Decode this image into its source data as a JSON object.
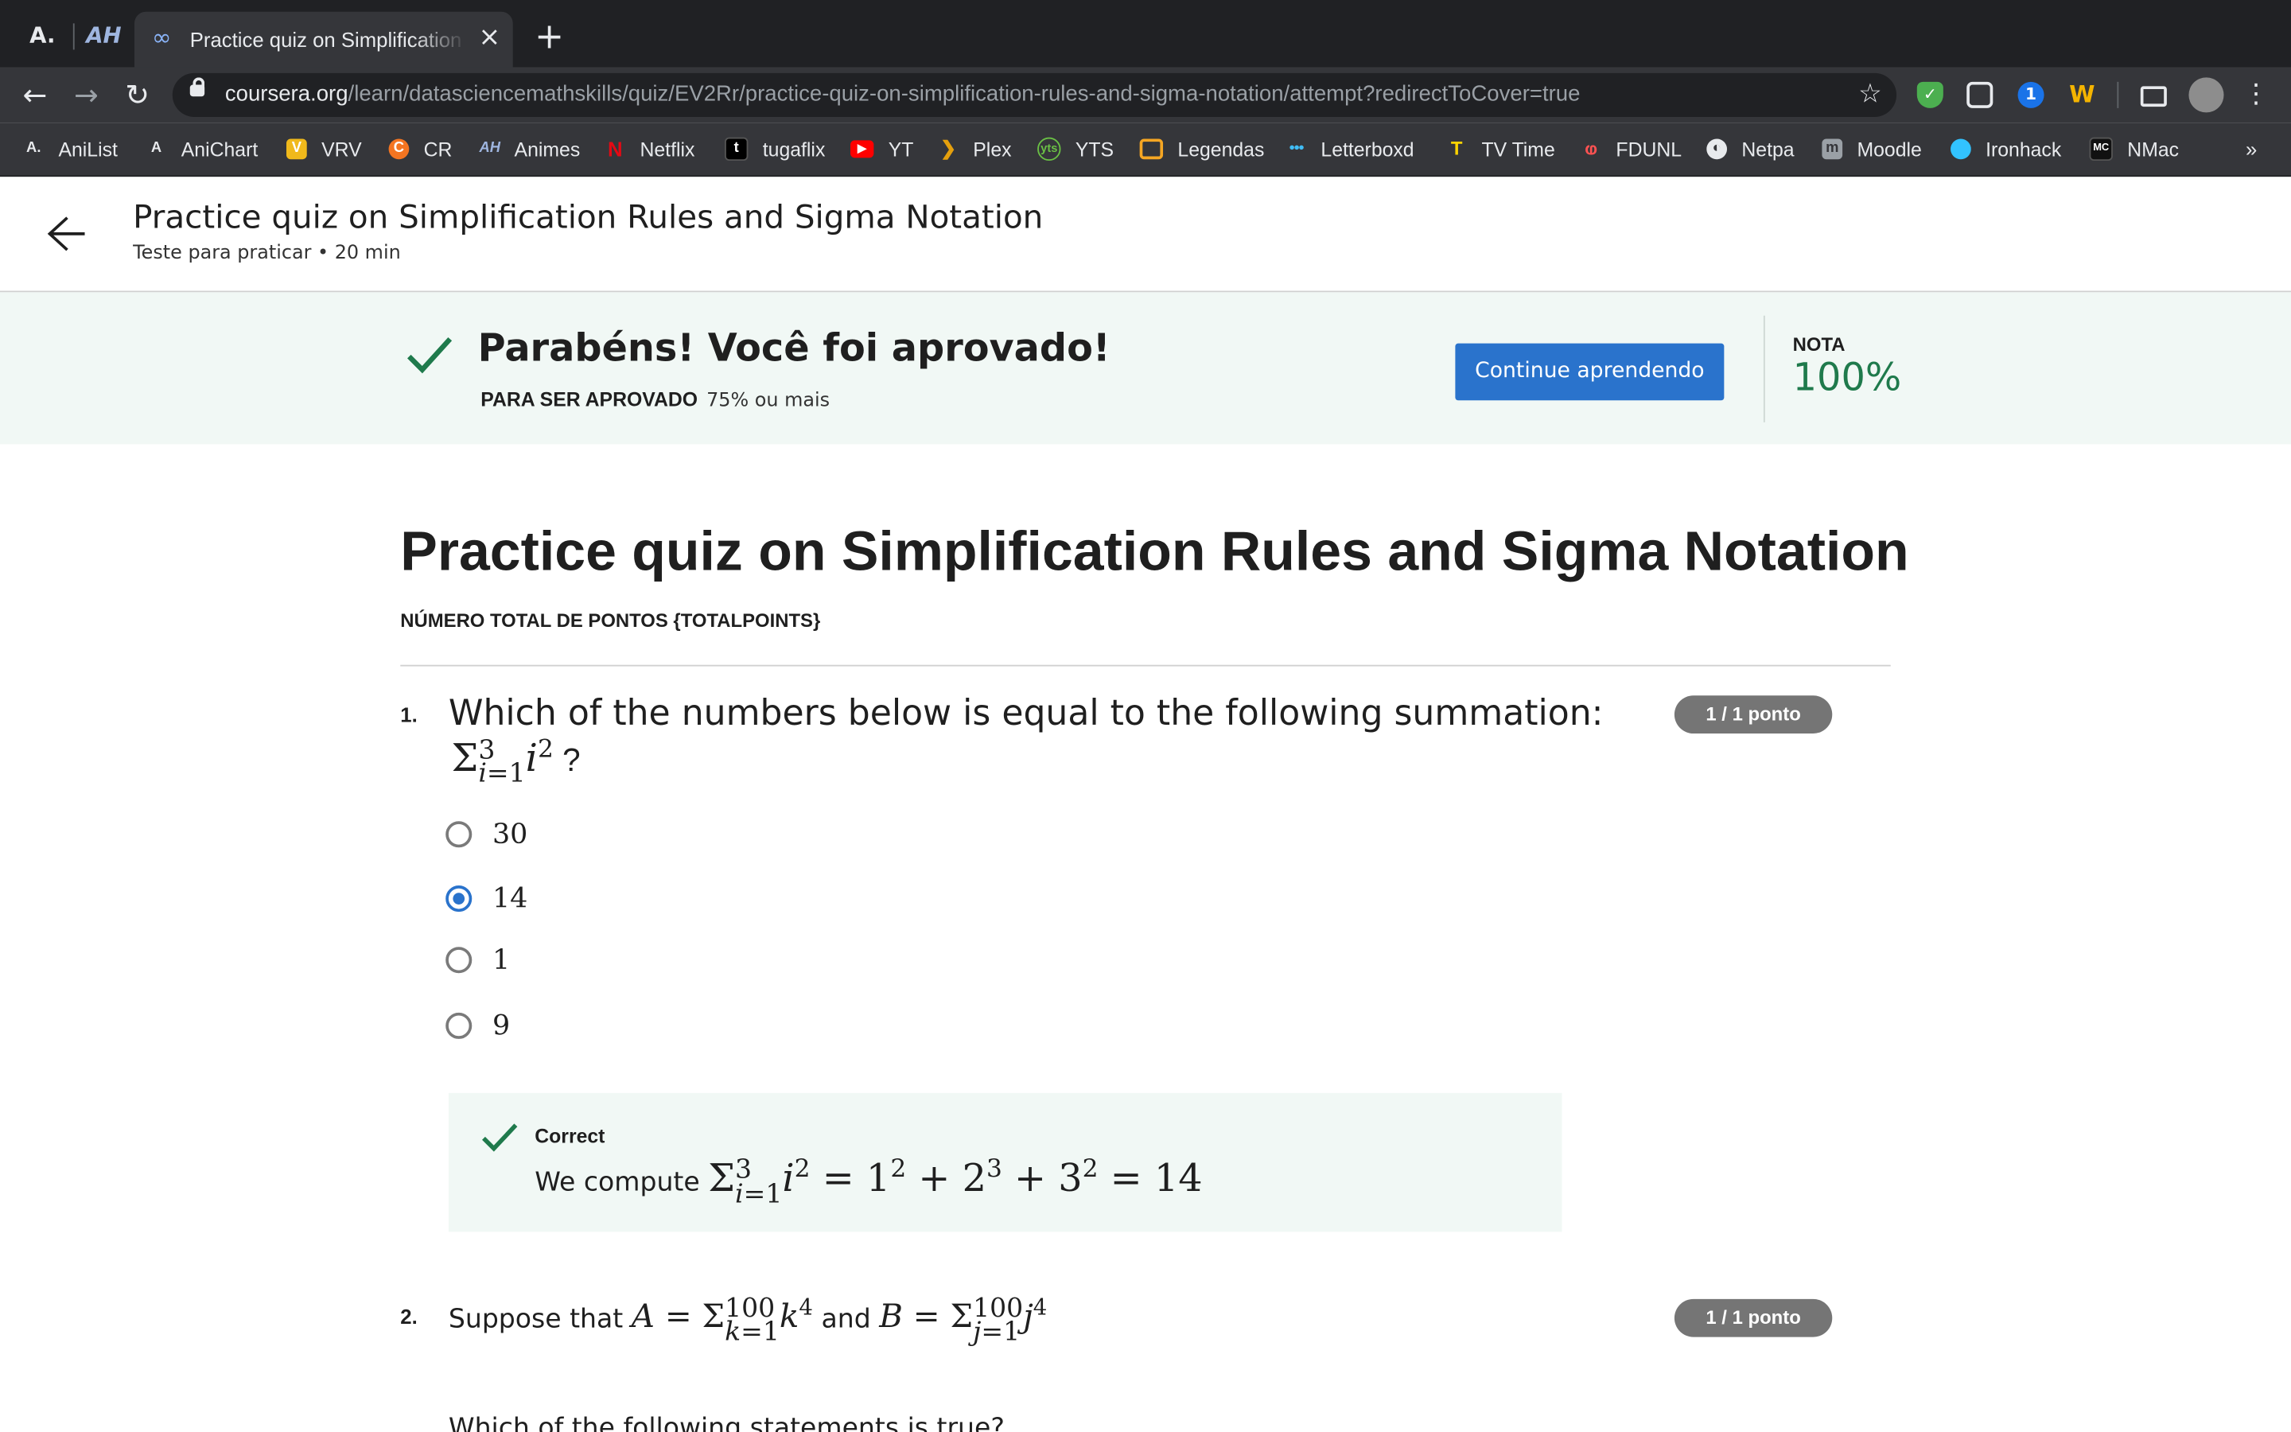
{
  "browser": {
    "tab_title": "Practice quiz on Simplification Rules and Sigma Notation | Coursera",
    "url_host": "coursera.org",
    "url_path": "/learn/datasciencemathskills/quiz/EV2Rr/practice-quiz-on-simplification-rules-and-sigma-notation/attempt?redirectToCover=true",
    "bookmarks": [
      {
        "label": "AniList",
        "color": "#3db4f2",
        "icon": "A."
      },
      {
        "label": "AniChart",
        "color": "#3db4f2",
        "icon": "A"
      },
      {
        "label": "VRV",
        "color": "#f0b91b",
        "icon": "V"
      },
      {
        "label": "CR",
        "color": "#f47521",
        "icon": "C"
      },
      {
        "label": "Animes",
        "color": "#6c8ebf",
        "icon": "AH"
      },
      {
        "label": "Netflix",
        "color": "#e50914",
        "icon": "N"
      },
      {
        "label": "tugaflix",
        "color": "#111111",
        "icon": "t"
      },
      {
        "label": "YT",
        "color": "#ff0000",
        "icon": "▶"
      },
      {
        "label": "Plex",
        "color": "#e5a00d",
        "icon": "❯"
      },
      {
        "label": "YTS",
        "color": "#6ac045",
        "icon": "y"
      },
      {
        "label": "Legendas",
        "color": "#f5a623",
        "icon": "L"
      },
      {
        "label": "Letterboxd",
        "color": "#40bcf4",
        "icon": "●"
      },
      {
        "label": "TV Time",
        "color": "#ffd400",
        "icon": "T"
      },
      {
        "label": "FDUNL",
        "color": "#d32f2f",
        "icon": "F"
      },
      {
        "label": "Netpa",
        "color": "#e8eaed",
        "icon": "◐"
      },
      {
        "label": "Moodle",
        "color": "#f98012",
        "icon": "m"
      },
      {
        "label": "Ironhack",
        "color": "#32c3ff",
        "icon": "I"
      },
      {
        "label": "NMac",
        "color": "#222222",
        "icon": "N"
      }
    ]
  },
  "header": {
    "title": "Practice quiz on Simplification Rules and Sigma Notation",
    "subtitle": "Teste para praticar • 20 min"
  },
  "banner": {
    "title": "Parabéns! Você foi aprovado!",
    "requirement_label": "PARA SER APROVADO",
    "requirement_value": "75% ou mais",
    "continue_label": "Continue aprendendo",
    "grade_label": "NOTA",
    "grade_value": "100%"
  },
  "quiz": {
    "title": "Practice quiz on Simplification Rules and Sigma Notation",
    "total_points": "NÚMERO TOTAL DE PONTOS {TOTALPOINTS}",
    "questions": [
      {
        "number": "1.",
        "text": "Which of the numbers below is equal to the following summation:",
        "score": "1 / 1 ponto",
        "options": [
          "30",
          "14",
          "1",
          "9"
        ],
        "selected_index": 1,
        "feedback_label": "Correct",
        "feedback_prefix": "We compute"
      },
      {
        "number": "2.",
        "text_prefix": "Suppose that",
        "text_and": "and",
        "score": "1 / 1 ponto",
        "next_line": "Which of the following statements is true?"
      }
    ]
  },
  "colors": {
    "accent": "#2a73cc",
    "success": "#1f7a4c",
    "banner_bg": "#f1f8f5"
  }
}
